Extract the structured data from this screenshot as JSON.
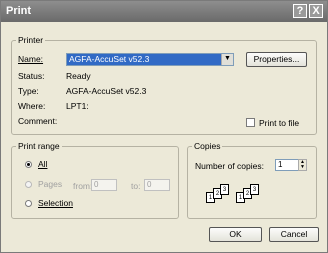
{
  "window": {
    "title": "Print",
    "help_label": "?",
    "close_label": "X"
  },
  "printer": {
    "group_label": "Printer",
    "name_label": "Name:",
    "name_value": "AGFA-AccuSet v52.3",
    "properties_label": "Properties...",
    "status_label": "Status:",
    "status_value": "Ready",
    "type_label": "Type:",
    "type_value": "AGFA-AccuSet v52.3",
    "where_label": "Where:",
    "where_value": "LPT1:",
    "comment_label": "Comment:",
    "print_to_file_label": "Print to file"
  },
  "print_range": {
    "group_label": "Print range",
    "all_label": "All",
    "pages_label": "Pages",
    "from_label": "from:",
    "from_value": "0",
    "to_label": "to:",
    "to_value": "0",
    "selection_label": "Selection"
  },
  "copies": {
    "group_label": "Copies",
    "number_label": "Number of copies:",
    "number_value": "1",
    "collate_pages": [
      "1",
      "2",
      "3"
    ]
  },
  "buttons": {
    "ok": "OK",
    "cancel": "Cancel"
  }
}
